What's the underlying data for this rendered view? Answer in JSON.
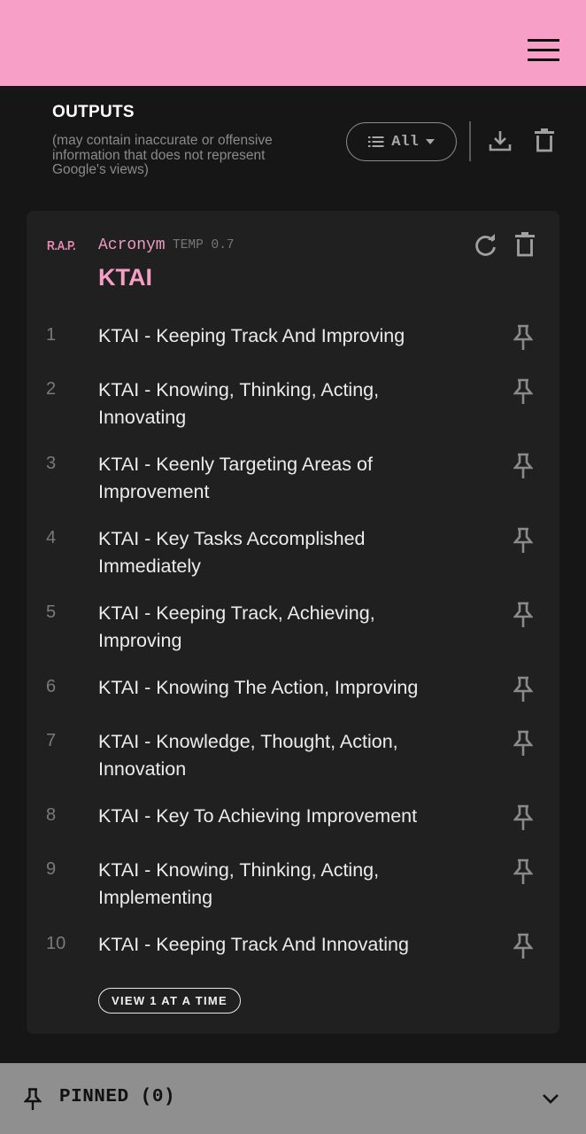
{
  "header": {
    "menu_icon": "hamburger-menu-icon",
    "accent": "#f89fc8"
  },
  "outputs": {
    "title": "OUTPUTS",
    "note": "(may contain inaccurate or offensive information that does not represent Google's views)",
    "filter_label": "All",
    "icons": [
      "list-icon",
      "caret-down-icon",
      "download-icon",
      "trash-icon"
    ]
  },
  "card": {
    "badge": "R.A.P.",
    "mode": "Acronym",
    "temp": "TEMP 0.7",
    "prompt": "KTAI",
    "items": [
      {
        "num": "1",
        "text": "KTAI - Keeping Track And Improving"
      },
      {
        "num": "2",
        "text": "KTAI - Knowing, Thinking, Acting, Innovating"
      },
      {
        "num": "3",
        "text": "KTAI - Keenly Targeting Areas of Improvement"
      },
      {
        "num": "4",
        "text": "KTAI - Key Tasks Accomplished Immediately"
      },
      {
        "num": "5",
        "text": "KTAI - Keeping Track, Achieving, Improving"
      },
      {
        "num": "6",
        "text": "KTAI - Knowing The Action, Improving"
      },
      {
        "num": "7",
        "text": "KTAI - Knowledge, Thought, Action, Innovation"
      },
      {
        "num": "8",
        "text": "KTAI - Key To Achieving Improvement"
      },
      {
        "num": "9",
        "text": "KTAI - Knowing, Thinking, Acting, Implementing"
      },
      {
        "num": "10",
        "text": "KTAI - Keeping Track And Innovating"
      }
    ],
    "view_label": "VIEW 1 AT A TIME"
  },
  "pinned": {
    "label": "PINNED (0)"
  }
}
